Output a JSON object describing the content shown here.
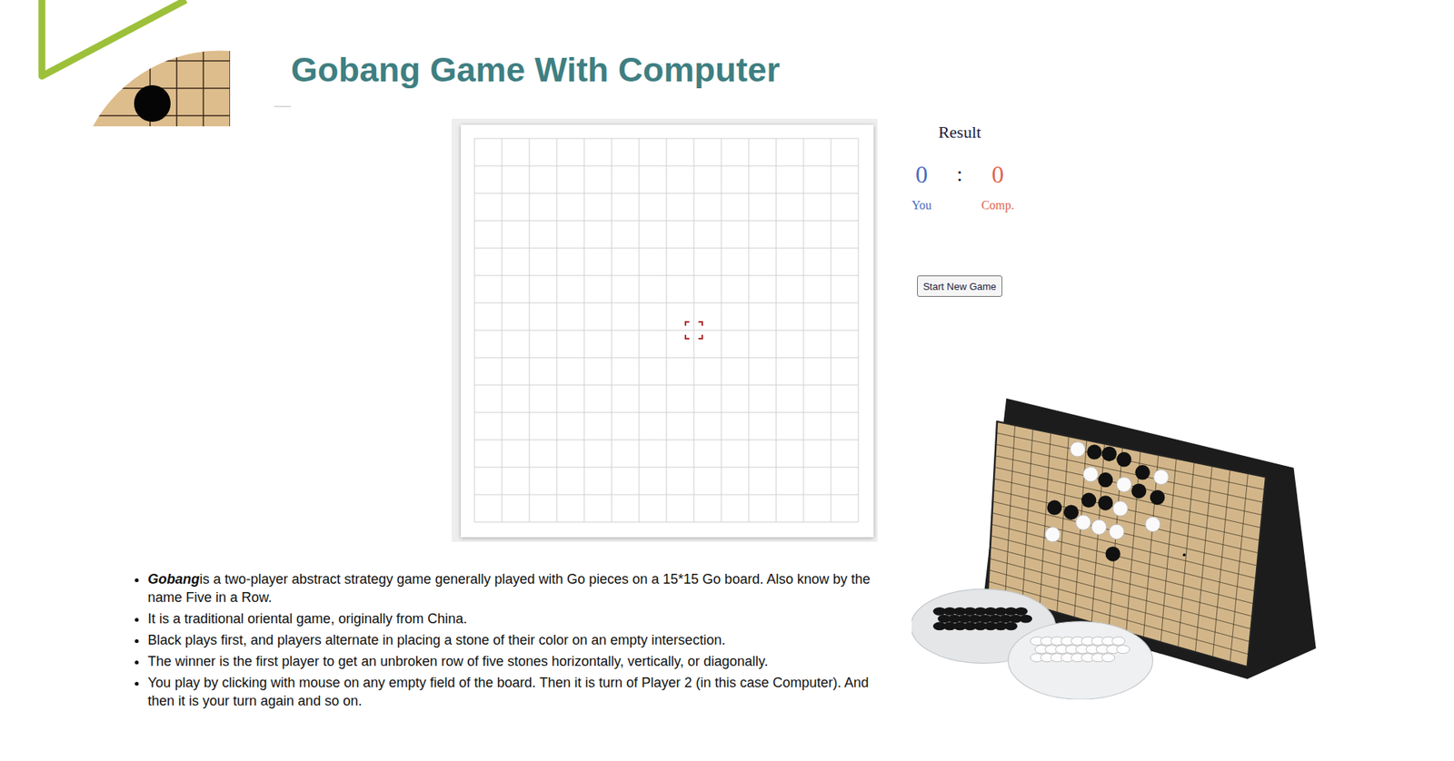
{
  "title": "Gobang Game With Computer",
  "board": {
    "size": 15,
    "stones": [],
    "hover": {
      "col": 8,
      "row": 7
    }
  },
  "result": {
    "heading": "Result",
    "separator": ":",
    "players": [
      {
        "label": "You",
        "score": "0",
        "color": "#4a6cc0"
      },
      {
        "label": "Comp.",
        "score": "0",
        "color": "#e0654f"
      }
    ]
  },
  "button": "Start New Game",
  "rules": [
    {
      "lead": "Gobang",
      "text": "is a two-player abstract strategy game generally played with Go pieces on a 15*15 Go board. Also know by the name Five in a Row."
    },
    {
      "lead": "",
      "text": "It is a traditional oriental game, originally from China."
    },
    {
      "lead": "",
      "text": "Black plays first, and players alternate in placing a stone of their color on an empty intersection."
    },
    {
      "lead": "",
      "text": "The winner is the first player to get an unbroken row of five stones horizontally, vertically, or diagonally."
    },
    {
      "lead": "",
      "text": "You play by clicking with mouse on any empty field of the board. Then it is turn of Player 2 (in this case Computer). And then it is your turn again and so on."
    }
  ]
}
